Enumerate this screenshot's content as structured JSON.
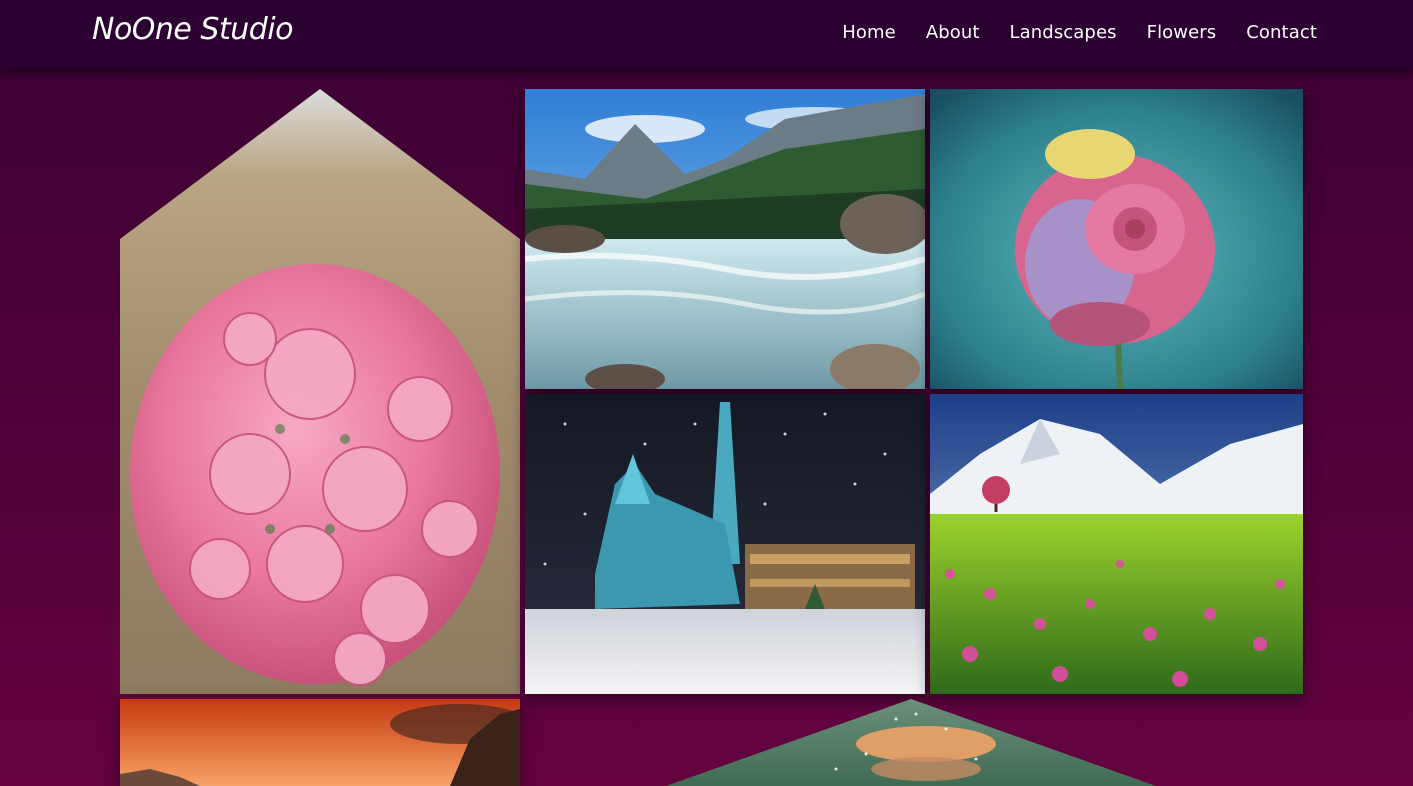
{
  "brand": {
    "name": "NoOne Studio"
  },
  "nav": {
    "items": [
      {
        "label": "Home"
      },
      {
        "label": "About"
      },
      {
        "label": "Landscapes"
      },
      {
        "label": "Flowers"
      },
      {
        "label": "Contact"
      }
    ]
  },
  "gallery": {
    "photos": [
      {
        "subject": "pink-rose-bouquet"
      },
      {
        "subject": "mountain-river"
      },
      {
        "subject": "rainbow-rose"
      },
      {
        "subject": "snowy-cathedral-night"
      },
      {
        "subject": "snow-mountain-flower-meadow"
      },
      {
        "subject": "sunset-canyon"
      },
      {
        "subject": "bokeh-lantern"
      }
    ]
  },
  "colors": {
    "header_bg": "#2b0131",
    "page_bg_top": "#3a0233",
    "page_bg_bottom": "#640340",
    "text": "#ffffff"
  }
}
